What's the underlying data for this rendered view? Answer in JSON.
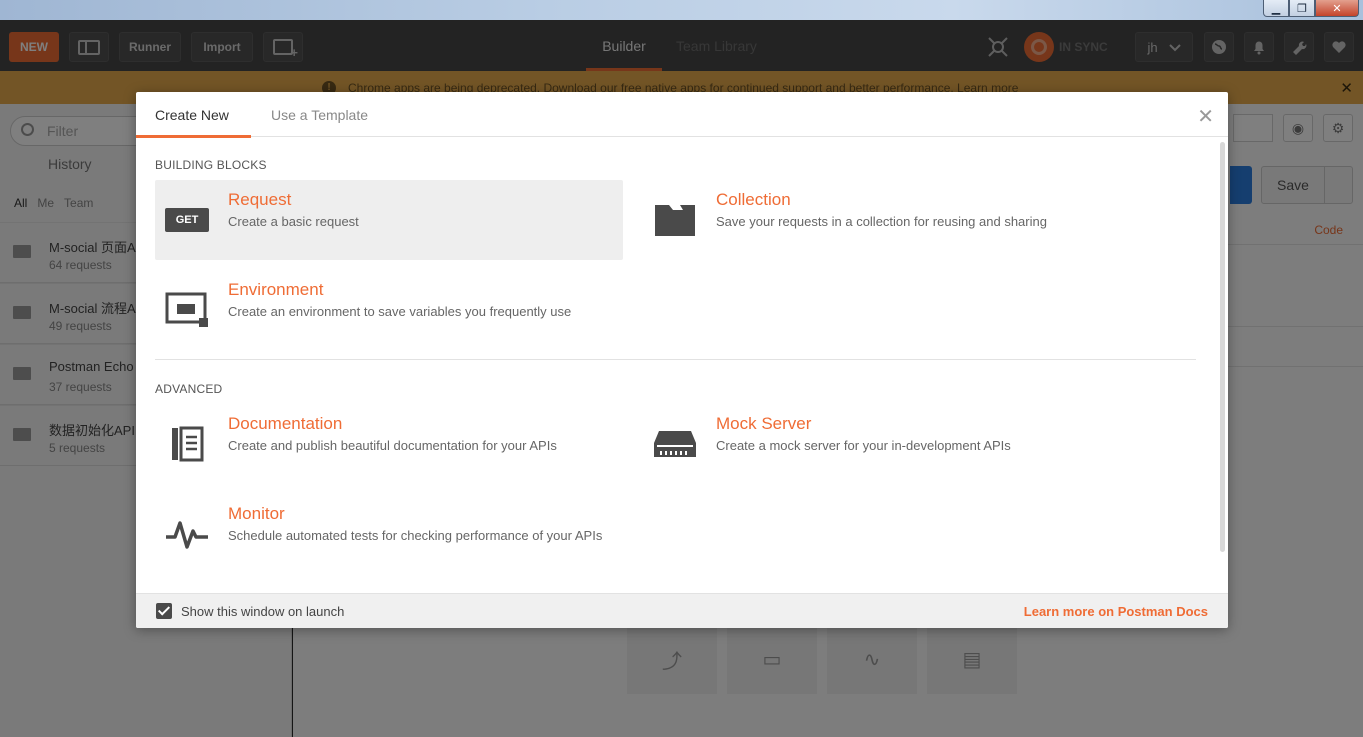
{
  "window": {
    "minimize": "▁",
    "maximize": "❐",
    "close": "✕"
  },
  "header": {
    "new_label": "NEW",
    "runner_label": "Runner",
    "import_label": "Import",
    "tabs": [
      {
        "label": "Builder"
      },
      {
        "label": "Team Library"
      }
    ],
    "sync_status": "IN SYNC",
    "user": "jh"
  },
  "banner": {
    "text": "Chrome apps are being deprecated. Download our free native apps for continued support and better performance. Learn more"
  },
  "sidebar": {
    "filter_placeholder": "Filter",
    "history_tab": "History",
    "subtabs": [
      "All",
      "Me",
      "Team"
    ],
    "collections": [
      {
        "name": "M-social 页面A",
        "count": "64 requests"
      },
      {
        "name": "M-social 流程A",
        "count": "49 requests"
      },
      {
        "name": "Postman Echo",
        "count": "37 requests"
      },
      {
        "name": "数据初始化API",
        "count": "5 requests"
      }
    ]
  },
  "main": {
    "save_label": "Save",
    "code_link": "Code"
  },
  "modal": {
    "tabs": [
      {
        "label": "Create New"
      },
      {
        "label": "Use a Template"
      }
    ],
    "close": "✕",
    "building_blocks_label": "BUILDING BLOCKS",
    "advanced_label": "ADVANCED",
    "get_badge": "GET",
    "items": {
      "request": {
        "title": "Request",
        "desc": "Create a basic request"
      },
      "collection": {
        "title": "Collection",
        "desc": "Save your requests in a collection for reusing and sharing"
      },
      "environment": {
        "title": "Environment",
        "desc": "Create an environment to save variables you frequently use"
      },
      "documentation": {
        "title": "Documentation",
        "desc": "Create and publish beautiful documentation for your APIs"
      },
      "mock_server": {
        "title": "Mock Server",
        "desc": "Create a mock server for your in-development APIs"
      },
      "monitor": {
        "title": "Monitor",
        "desc": "Schedule automated tests for checking performance of your APIs"
      }
    },
    "footer": {
      "show_on_launch_label": "Show this window on launch",
      "show_on_launch_checked": true,
      "docs_link": "Learn more on Postman Docs"
    }
  },
  "colors": {
    "accent": "#ef6c35",
    "header_bg": "#464646",
    "banner_bg": "#e6ab4c"
  }
}
